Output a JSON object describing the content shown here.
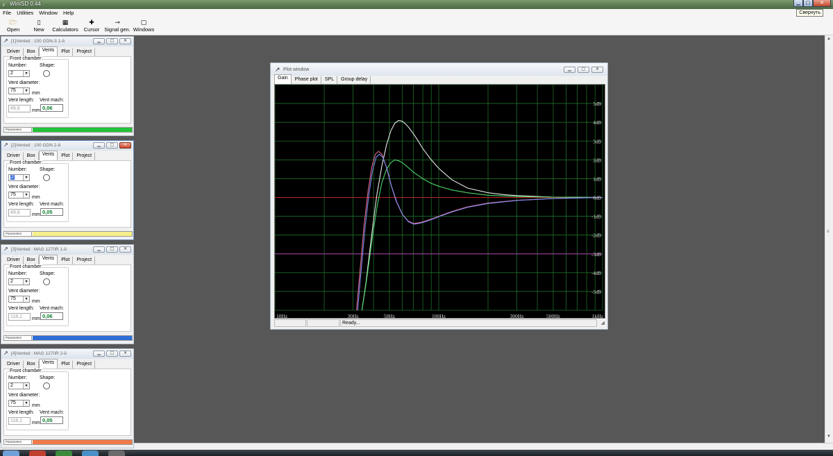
{
  "app": {
    "title": "WinISD 0.44",
    "tooltip_minimize": "Свернуть"
  },
  "menu": [
    "File",
    "Utilities",
    "Window",
    "Help"
  ],
  "toolbar": [
    {
      "label": "Open",
      "icon": "open-folder-icon",
      "glyph": "🗁"
    },
    {
      "label": "New",
      "icon": "new-document-icon",
      "glyph": "▯"
    },
    {
      "label": "Calculators",
      "icon": "calculator-icon",
      "glyph": "▦"
    },
    {
      "label": "Cursor",
      "icon": "cursor-icon",
      "glyph": "✚"
    },
    {
      "label": "Signal gen.",
      "icon": "signal-generator-icon",
      "glyph": "⊸"
    },
    {
      "label": "Windows",
      "icon": "windows-icon",
      "glyph": "▢"
    }
  ],
  "common": {
    "tabs": [
      "Driver",
      "Box",
      "Vents",
      "Plot",
      "Project"
    ],
    "active_tab": "Vents",
    "group_label": "Front chamber:",
    "number_label": "Number:",
    "shape_label": "Shape:",
    "diameter_label": "Vent diameter:",
    "length_label": "Vent length:",
    "mach_label": "Vent mach:",
    "unit_mm": "mm",
    "status_label": "Parameters"
  },
  "projects": [
    {
      "title": "[1]Vented : 100 GDN-3 1-й",
      "number": "2",
      "diameter": "75",
      "length": "49,6",
      "mach": "0,06",
      "color": "#22c33a",
      "number_selected": false,
      "active": false
    },
    {
      "title": "[2]Vented : 100 GDN 2-й",
      "number": "2",
      "diameter": "75",
      "length": "49,6",
      "mach": "0,05",
      "color": "#f6f08a",
      "number_selected": true,
      "active": true
    },
    {
      "title": "[3]Vented : MAG 1270R 1-й",
      "number": "2",
      "diameter": "75",
      "length": "118,1",
      "mach": "0,06",
      "color": "#2d6fd6",
      "number_selected": false,
      "active": false
    },
    {
      "title": "[4]Vented : MAG 1270R 2-й",
      "number": "2",
      "diameter": "75",
      "length": "118,1",
      "mach": "0,05",
      "color": "#f07a4a",
      "number_selected": false,
      "active": false
    }
  ],
  "plot_window": {
    "title": "Plot window",
    "tabs": [
      "Gain",
      "Phase plot",
      "SPL",
      "Group delay"
    ],
    "active_tab": "Gain",
    "status_text": "Ready..."
  },
  "chart_data": {
    "type": "line",
    "xscale": "log",
    "xlim": [
      10,
      1000
    ],
    "ylim": [
      -6,
      6
    ],
    "x_tick_labels": [
      {
        "value": 10,
        "label": "10Hz"
      },
      {
        "value": 30,
        "label": "30Hz"
      },
      {
        "value": 50,
        "label": "50Hz"
      },
      {
        "value": 100,
        "label": "100Hz"
      },
      {
        "value": 300,
        "label": "300Hz"
      },
      {
        "value": 500,
        "label": "500Hz"
      },
      {
        "value": 1000,
        "label": "1kHz"
      }
    ],
    "y_tick_labels": [
      {
        "value": 5,
        "label": "5dB"
      },
      {
        "value": 4,
        "label": "4dB"
      },
      {
        "value": 3,
        "label": "3dB"
      },
      {
        "value": 2,
        "label": "2dB"
      },
      {
        "value": 1,
        "label": "1dB"
      },
      {
        "value": 0,
        "label": "0dB"
      },
      {
        "value": -1,
        "label": "-1dB"
      },
      {
        "value": -2,
        "label": "-2dB"
      },
      {
        "value": -3,
        "label": "-3dB"
      },
      {
        "value": -4,
        "label": "-4dB"
      },
      {
        "value": -5,
        "label": "-5dB"
      }
    ],
    "reference_lines": [
      {
        "y": 0,
        "color": "#c02020"
      },
      {
        "y": -3,
        "color": "#b040b0"
      }
    ],
    "grid": true,
    "series": [
      {
        "color": "#e8e8e8",
        "x": [
          34,
          36,
          38,
          40,
          42,
          45,
          48,
          51,
          54,
          57,
          60,
          63,
          66,
          70,
          75,
          80,
          90,
          100,
          120,
          150,
          200,
          250,
          300,
          400,
          500,
          700,
          1000
        ],
        "y": [
          -6,
          -4.5,
          -2.8,
          -1.2,
          0.2,
          1.7,
          2.8,
          3.55,
          3.95,
          4.1,
          4.05,
          3.9,
          3.7,
          3.4,
          3.0,
          2.6,
          2.0,
          1.55,
          0.95,
          0.5,
          0.25,
          0.15,
          0.1,
          0.05,
          0.02,
          0.01,
          0
        ]
      },
      {
        "color": "#4cd36a",
        "x": [
          34,
          36,
          38,
          40,
          42,
          45,
          48,
          51,
          54,
          57,
          60,
          65,
          70,
          80,
          90,
          100,
          120,
          150,
          200,
          300,
          500,
          1000
        ],
        "y": [
          -6,
          -4.6,
          -3.1,
          -1.7,
          -0.5,
          0.8,
          1.5,
          1.85,
          2.0,
          1.95,
          1.85,
          1.6,
          1.35,
          1.0,
          0.75,
          0.6,
          0.4,
          0.25,
          0.12,
          0.05,
          0.02,
          0
        ]
      },
      {
        "color": "#e06a8a",
        "x": [
          31.5,
          33,
          35,
          37,
          39,
          41,
          43,
          45,
          48,
          51,
          55,
          60,
          65,
          70,
          75,
          80,
          90,
          100,
          120,
          150,
          200,
          300,
          500,
          1000
        ],
        "y": [
          -6,
          -4.0,
          -1.5,
          0.3,
          1.6,
          2.3,
          2.45,
          2.3,
          1.6,
          0.7,
          -0.2,
          -0.9,
          -1.25,
          -1.38,
          -1.35,
          -1.3,
          -1.15,
          -1.0,
          -0.75,
          -0.5,
          -0.3,
          -0.15,
          -0.05,
          0
        ]
      },
      {
        "color": "#7a8cf0",
        "x": [
          32,
          33.5,
          35.5,
          37.5,
          39.5,
          41.5,
          43.5,
          45.5,
          48.5,
          51.5,
          55.5,
          60.5,
          65.5,
          70.5,
          75.5,
          80.5,
          90.5,
          100.5,
          120.5,
          150.5,
          200.5,
          300.5,
          500.5,
          1000
        ],
        "y": [
          -6,
          -4.0,
          -1.6,
          0.2,
          1.45,
          2.15,
          2.3,
          2.15,
          1.5,
          0.6,
          -0.25,
          -0.95,
          -1.3,
          -1.42,
          -1.38,
          -1.32,
          -1.17,
          -1.02,
          -0.77,
          -0.52,
          -0.32,
          -0.16,
          -0.06,
          0
        ]
      }
    ]
  }
}
